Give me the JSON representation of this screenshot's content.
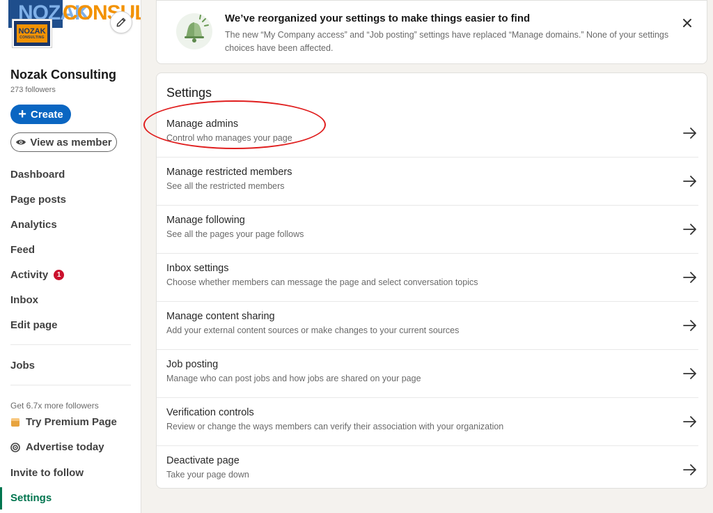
{
  "sidebar": {
    "cover_text": "CONSULTI",
    "cover_left_text": "NOZAK",
    "logo_main": "NOZAK",
    "logo_sub": "CONSULTING",
    "org_name": "Nozak Consulting",
    "followers": "273 followers",
    "create_label": "Create",
    "view_as_member_label": "View as member",
    "nav": [
      {
        "label": "Dashboard"
      },
      {
        "label": "Page posts"
      },
      {
        "label": "Analytics"
      },
      {
        "label": "Feed"
      },
      {
        "label": "Activity",
        "badge": "1"
      },
      {
        "label": "Inbox"
      },
      {
        "label": "Edit page"
      },
      {
        "label": "Jobs"
      }
    ],
    "promo_text": "Get 6.7x more followers",
    "premium_label": "Try Premium Page",
    "advertise_label": "Advertise today",
    "invite_label": "Invite to follow",
    "settings_label": "Settings"
  },
  "notice": {
    "title": "We’ve reorganized your settings to make things easier to find",
    "body": "The new “My Company access” and “Job posting” settings have replaced “Manage domains.” None of your settings choices have been affected.",
    "icon": "bell-icon"
  },
  "settings": {
    "title": "Settings",
    "rows": [
      {
        "title": "Manage admins",
        "subtitle": "Control who manages your page"
      },
      {
        "title": "Manage restricted members",
        "subtitle": "See all the restricted members"
      },
      {
        "title": "Manage following",
        "subtitle": "See all the pages your page follows"
      },
      {
        "title": "Inbox settings",
        "subtitle": "Choose whether members can message the page and select conversation topics"
      },
      {
        "title": "Manage content sharing",
        "subtitle": "Add your external content sources or make changes to your current sources"
      },
      {
        "title": "Job posting",
        "subtitle": "Manage who can post jobs and how jobs are shared on your page"
      },
      {
        "title": "Verification controls",
        "subtitle": "Review or change the ways members can verify their association with your organization"
      },
      {
        "title": "Deactivate page",
        "subtitle": "Take your page down"
      }
    ]
  },
  "colors": {
    "primary": "#0a66c2",
    "active_green": "#01754f",
    "badge_red": "#cb112d",
    "annotation_red": "#e01e1e",
    "brand_orange": "#f39200"
  }
}
